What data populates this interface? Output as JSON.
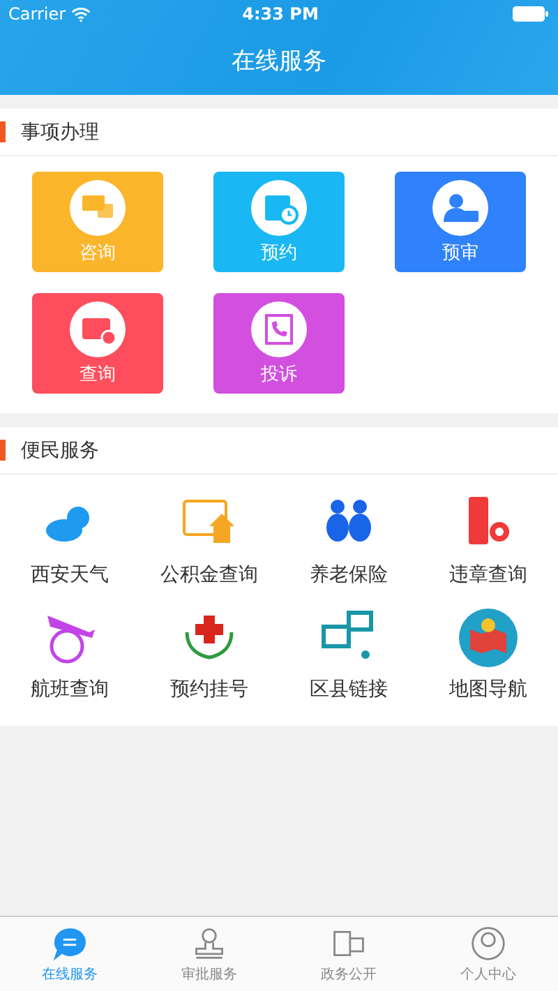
{
  "status_bar": {
    "carrier": "Carrier",
    "time": "4:33 PM"
  },
  "nav": {
    "title": "在线服务"
  },
  "sections": [
    {
      "title": "事项办理",
      "kind": "tiles",
      "items": [
        {
          "label": "咨询",
          "color": "#fbb52a"
        },
        {
          "label": "预约",
          "color": "#19b8f5"
        },
        {
          "label": "预审",
          "color": "#2f82fb"
        },
        {
          "label": "查询",
          "color": "#fe4d5c"
        },
        {
          "label": "投诉",
          "color": "#d24fe0"
        }
      ]
    },
    {
      "title": "便民服务",
      "kind": "grid",
      "items": [
        {
          "label": "西安天气"
        },
        {
          "label": "公积金查询"
        },
        {
          "label": "养老保险"
        },
        {
          "label": "违章查询"
        },
        {
          "label": "航班查询"
        },
        {
          "label": "预约挂号"
        },
        {
          "label": "区县链接"
        },
        {
          "label": "地图导航"
        }
      ]
    }
  ],
  "tab_bar": [
    {
      "label": "在线服务",
      "selected": true
    },
    {
      "label": "审批服务",
      "selected": false
    },
    {
      "label": "政务公开",
      "selected": false
    },
    {
      "label": "个人中心",
      "selected": false
    }
  ]
}
